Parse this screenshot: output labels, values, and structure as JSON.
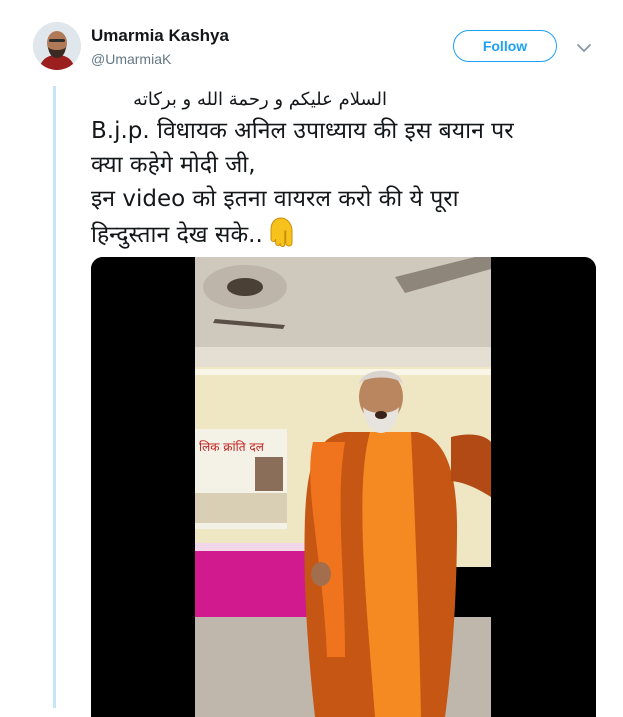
{
  "user": {
    "display_name": "Umarmia Kashya",
    "handle": "@UmarmiaK"
  },
  "actions": {
    "follow_label": "Follow",
    "caret_icon": "chevron-down-icon"
  },
  "tweet": {
    "greeting": "السلام عليكم و رحمة الله و بركاته",
    "lines": [
      "B.j.p. विधायक अनिल उपाध्याय की इस बयान पर",
      "क्या कहेगे मोदी जी,",
      " इन video को इतना वायरल करो की ये पूरा",
      "हिन्दुस्तान देख सके.."
    ],
    "emoji_icon": "pointing-down-hand-icon"
  },
  "media": {
    "banner_text": "लिक क्रांति दल"
  },
  "colors": {
    "accent": "#1da1f2",
    "thread_line": "#c8e4f7",
    "saffron": "#f07a1a"
  }
}
